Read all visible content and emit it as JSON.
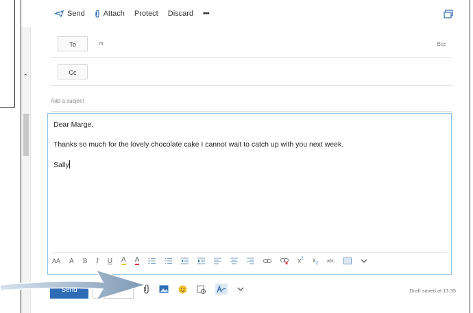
{
  "toolbar": {
    "send_label": "Send",
    "attach_label": "Attach",
    "protect_label": "Protect",
    "discard_label": "Discard",
    "more_label": "•••"
  },
  "fields": {
    "to_label": "To",
    "to_value": "m",
    "bcc_label": "Bcc",
    "cc_label": "Cc",
    "subject_placeholder": "Add a subject"
  },
  "message": {
    "greeting": "Dear Marge,",
    "line1": "Thanks so much for the lovely chocolate cake I cannot wait to catch up with you next week.",
    "signoff": "Sally"
  },
  "format_bar": {
    "font_size_label": "AA",
    "grow_label": "A",
    "bold_label": "B",
    "italic_label": "I",
    "underline_label": "U",
    "highlight_label": "A",
    "font_color_label": "A",
    "superscript_label": "x",
    "subscript_label": "x",
    "spell_label": "abc"
  },
  "actions": {
    "send_label": "Send",
    "discard_label": "Di",
    "draft_status": "Draft saved at 13:35"
  },
  "colors": {
    "accent": "#2e6cb5",
    "focus_border": "#8fc1ea",
    "arrow": "#7a9fc4"
  }
}
